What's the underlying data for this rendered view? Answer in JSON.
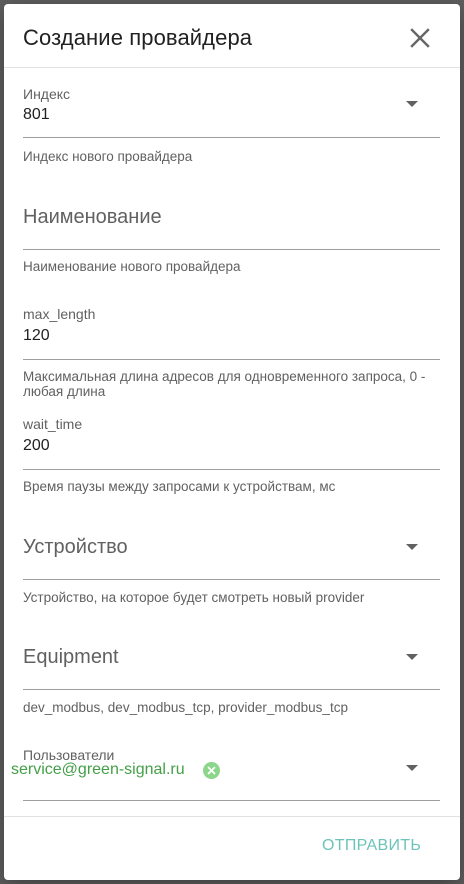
{
  "dialog": {
    "title": "Создание провайдера",
    "close_icon": "close-icon"
  },
  "fields": {
    "index": {
      "label": "Индекс",
      "value": "801",
      "hint": "Индекс нового провайдера",
      "icon": "chevron-down-icon"
    },
    "name": {
      "placeholder": "Наименование",
      "hint": "Наименование нового провайдера"
    },
    "max_length": {
      "label": "max_length",
      "value": "120",
      "hint": "Максимальная длина адресов для одновременного запроса, 0 - любая длина"
    },
    "wait_time": {
      "label": "wait_time",
      "value": "200",
      "hint": "Время паузы между запросами к устройствам, мс"
    },
    "device": {
      "placeholder": "Устройство",
      "hint": "Устройство, на которое будет смотреть новый provider",
      "icon": "chevron-down-icon"
    },
    "equipment": {
      "placeholder": "Equipment",
      "hint": "dev_modbus, dev_modbus_tcp, provider_modbus_tcp",
      "icon": "chevron-down-icon"
    },
    "users": {
      "label": "Пользователи",
      "chips": [
        "service@green-signal.ru"
      ],
      "chip_remove_icon": "close-circle-icon",
      "icon": "chevron-down-icon"
    }
  },
  "footer": {
    "submit_label": "ОТПРАВИТЬ"
  },
  "colors": {
    "accent": "#6cc3ba",
    "chip": "#43a047",
    "chip_remove": "#8bd68b",
    "overlay": "#5f5f5f"
  }
}
